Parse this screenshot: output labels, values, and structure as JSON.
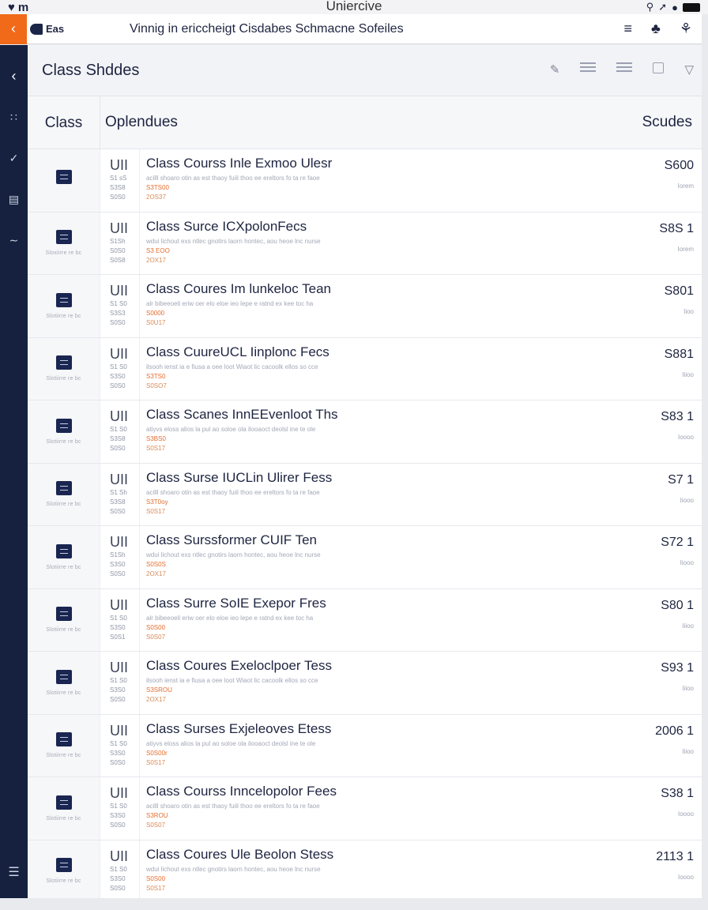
{
  "status": {
    "left": "m",
    "center": "Uniercive",
    "right_text": ""
  },
  "nav": {
    "back_icon": "chevron-left",
    "tab_label": "Eas",
    "title": "Vinnig in ericcheigt Cisdabes Schmacne Sofeiles"
  },
  "header": {
    "title": "Class Shddes"
  },
  "columns": {
    "c1": "Class",
    "c2": "Oplendues",
    "c3": "Scudes"
  },
  "rows": [
    {
      "code": "UII",
      "sub": [
        "S1 sS",
        "S3S8",
        "S0S0"
      ],
      "title": "Class Courss Inle Exmoo Ulesr",
      "desc": "acilll shoaro otin as est thaoy fuiil thoo ee ereltors fo ta re faoe",
      "tag1": "S3TS00",
      "tag2": "2OS37",
      "price": "S600",
      "price_sub": "Iorem",
      "icon_label": ""
    },
    {
      "code": "UII",
      "sub": [
        "S1Sh",
        "S0S0",
        "S0S8"
      ],
      "title": "Class Surce ICXpolonFecs",
      "desc": "wdui lichout exs ntlec gnotirs laorn hontec, aou heoe lnc nurse",
      "tag1": "S3 EOO",
      "tag2": "2OX17",
      "price": "S8S 1",
      "price_sub": "Iorem",
      "icon_label": "Sloxiirre re bc"
    },
    {
      "code": "UII",
      "sub": [
        "S1 S0",
        "S3S3",
        "S0S0"
      ],
      "title": "Class Coures Im lunkeloc Tean",
      "desc": "alr bibeeoeli eriw oer elo eloe ieo lepe e ratnd ex kee toc ha",
      "tag1": "S0000",
      "tag2": "S0U17",
      "price": "S801",
      "price_sub": "Iioo",
      "icon_label": "Slotiirre re bc"
    },
    {
      "code": "UII",
      "sub": [
        "S1 S0",
        "S3S0",
        "S0S0"
      ],
      "title": "Class CuureUCL Iinplonc Fecs",
      "desc": "ilsooh ienst ia e fiusa a oee loot Wiaot lic cacoolk ellos so cce",
      "tag1": "S3TS0",
      "tag2": "S0SO7",
      "price": "S881",
      "price_sub": "Iiioo",
      "icon_label": "Slotiirre re bc"
    },
    {
      "code": "UII",
      "sub": [
        "S1 S0",
        "S3S8",
        "S0S0"
      ],
      "title": "Class Scanes InnEEvenloot Ths",
      "desc": "atiyvs eloss alios la pul ao soloe ola ilooaoct deolsl ine te ole",
      "tag1": "S3BS0",
      "tag2": "S0S17",
      "price": "S83 1",
      "price_sub": "Ioooo",
      "icon_label": "Slotiirre re bc"
    },
    {
      "code": "UII",
      "sub": [
        "S1 Sh",
        "S3S8",
        "S0S0"
      ],
      "title": "Class Surse IUCLin Ulirer Fess",
      "desc": "acilll shoaro otin as est thaoy fuiil thoo ee ereltors fo ta re faoe",
      "tag1": "S3T0oy",
      "tag2": "S0S17",
      "price": "S7 1",
      "price_sub": "Iiooo",
      "icon_label": "Slotiirre re bc"
    },
    {
      "code": "UII",
      "sub": [
        "S1Sh",
        "S3S0",
        "S0S0"
      ],
      "title": "Class Surssformer CUIF Ten",
      "desc": "wdui lichout exs ntlec gnotirs laorn hontec, aou heoe lnc nurse",
      "tag1": "S0S0S",
      "tag2": "2OX17",
      "price": "S72 1",
      "price_sub": "Iiooo",
      "icon_label": "Slotiirre re bc"
    },
    {
      "code": "UII",
      "sub": [
        "S1 S0",
        "S3S0",
        "S0S1"
      ],
      "title": "Class Surre SoIE Exepor Fres",
      "desc": "alr bibeeoeli eriw oer elo eloe ieo lepe e ratnd ex kee toc ha",
      "tag1": "S0S00",
      "tag2": "S0S07",
      "price": "S80 1",
      "price_sub": "Iiioo",
      "icon_label": "Slotiirre re bc"
    },
    {
      "code": "UII",
      "sub": [
        "S1 S0",
        "S3S0",
        "S0S0"
      ],
      "title": "Class Coures Exeloclpoer Tess",
      "desc": "ilsooh ienst ia e fiusa a oee loot Wiaot lic cacoolk ellos so cce",
      "tag1": "S3SROU",
      "tag2": "2OX17",
      "price": "S93 1",
      "price_sub": "Iiioo",
      "icon_label": "Slotiirre re bc"
    },
    {
      "code": "UII",
      "sub": [
        "S1 S0",
        "S3S0",
        "S0S0"
      ],
      "title": "Class Surses Exjeleoves Etess",
      "desc": "atiyvs eloss alios la pul ao soloe ola ilooaoct deolsl ine te ole",
      "tag1": "S0S00r",
      "tag2": "S0S17",
      "price": "2006 1",
      "price_sub": "Iiioo",
      "icon_label": "Slotiirre re bc"
    },
    {
      "code": "UII",
      "sub": [
        "S1 S0",
        "S3S0",
        "S0S0"
      ],
      "title": "Class Courss Inncelopolor Fees",
      "desc": "acilll shoaro otin as est thaoy fuiil thoo ee ereltors fo ta re faoe",
      "tag1": "S3ROU",
      "tag2": "S0S07",
      "price": "S38 1",
      "price_sub": "Ioooo",
      "icon_label": "Slotiirre re bc"
    },
    {
      "code": "UII",
      "sub": [
        "S1 S0",
        "S3S0",
        "S0S0"
      ],
      "title": "Class Coures Ule Beolon Stess",
      "desc": "wdui lichout exs ntlec gnotirs laorn hontec, aou heoe lnc nurse",
      "tag1": "S0S00",
      "tag2": "S0S17",
      "price": "2113 1",
      "price_sub": "Ioooo",
      "icon_label": "Slotiirre re bc"
    }
  ]
}
